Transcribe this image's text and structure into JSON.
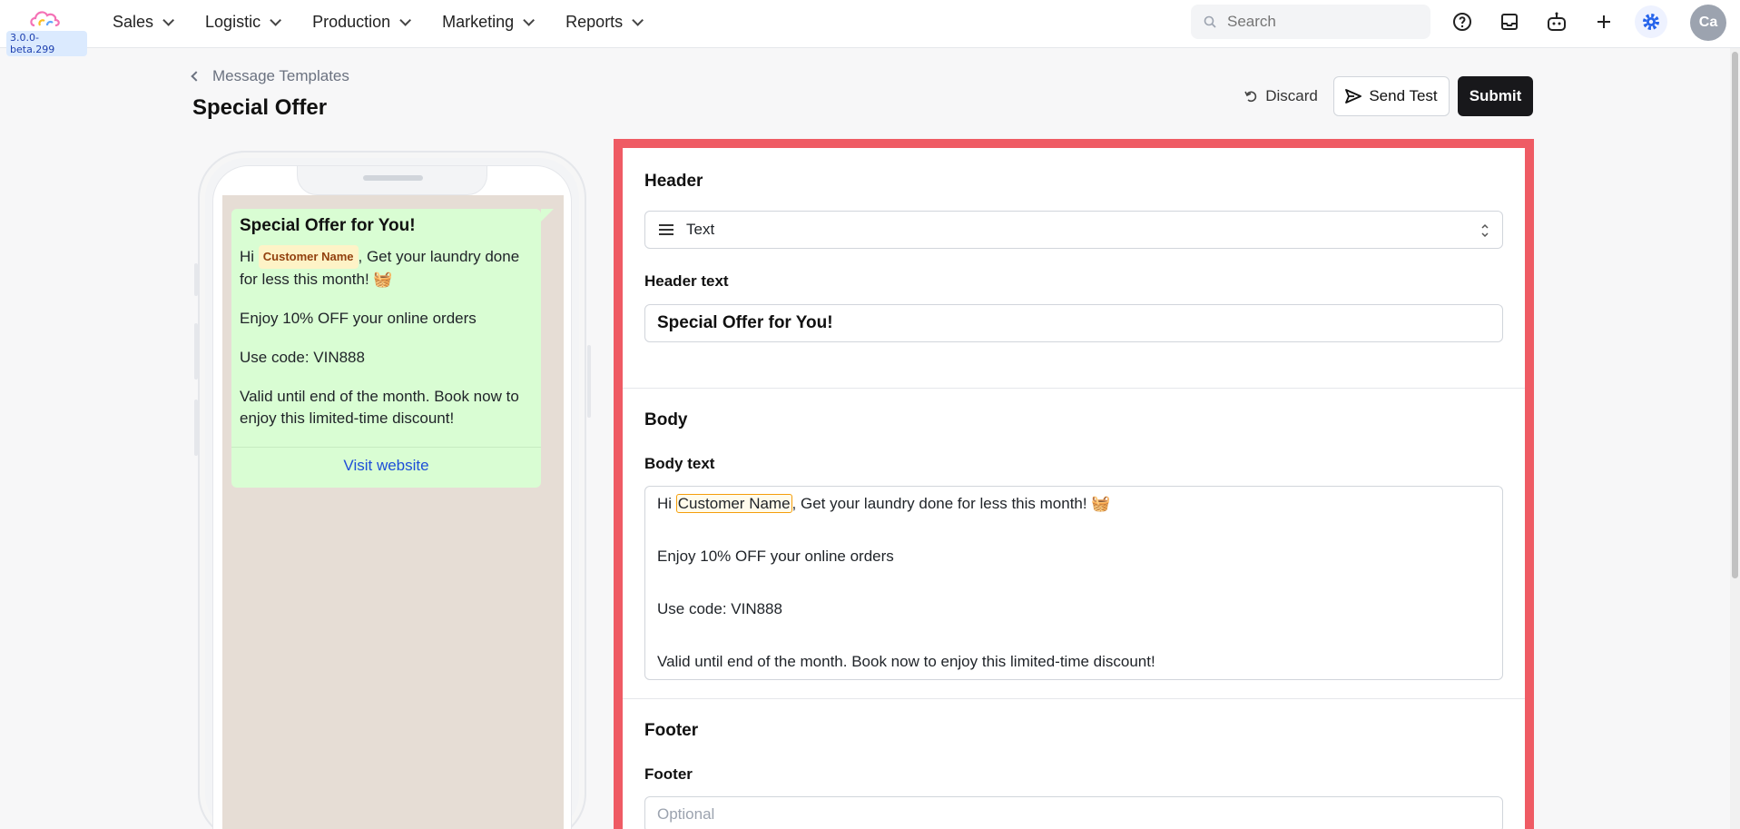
{
  "app": {
    "version": "3.0.0-beta.299"
  },
  "nav": {
    "items": [
      {
        "label": "Sales"
      },
      {
        "label": "Logistic"
      },
      {
        "label": "Production"
      },
      {
        "label": "Marketing"
      },
      {
        "label": "Reports"
      }
    ],
    "search_placeholder": "Search",
    "avatar_initials": "Ca",
    "accent": "#2563eb"
  },
  "page": {
    "breadcrumb": "Message Templates",
    "title": "Special Offer",
    "actions": {
      "discard": "Discard",
      "send_test": "Send Test",
      "submit": "Submit"
    }
  },
  "preview": {
    "header": "Special Offer for You!",
    "line1_prefix": "Hi",
    "variable": "Customer Name",
    "line1_suffix": ", Get your laundry done for less this month! 🧺",
    "line2": "Enjoy 10% OFF your online orders",
    "line3": "Use code: VIN888",
    "line4": "Valid until end of the month. Book now to enjoy this limited-time discount!",
    "button": "Visit website"
  },
  "form": {
    "header": {
      "section_title": "Header",
      "type_value": "Text",
      "text_label": "Header text",
      "text_value": "Special Offer for You!"
    },
    "body": {
      "section_title": "Body",
      "text_label": "Body text",
      "line1_prefix": "Hi ",
      "variable": "Customer Name",
      "line1_suffix": ", Get your laundry done for less this month! 🧺",
      "line2": "Enjoy 10% OFF your online orders",
      "line3": "Use code: VIN888",
      "line4": "Valid until end of the month. Book now to enjoy this limited-time discount!"
    },
    "footer": {
      "section_title": "Footer",
      "label": "Footer",
      "placeholder": "Optional"
    },
    "highlight_color": "#ef5b64"
  }
}
